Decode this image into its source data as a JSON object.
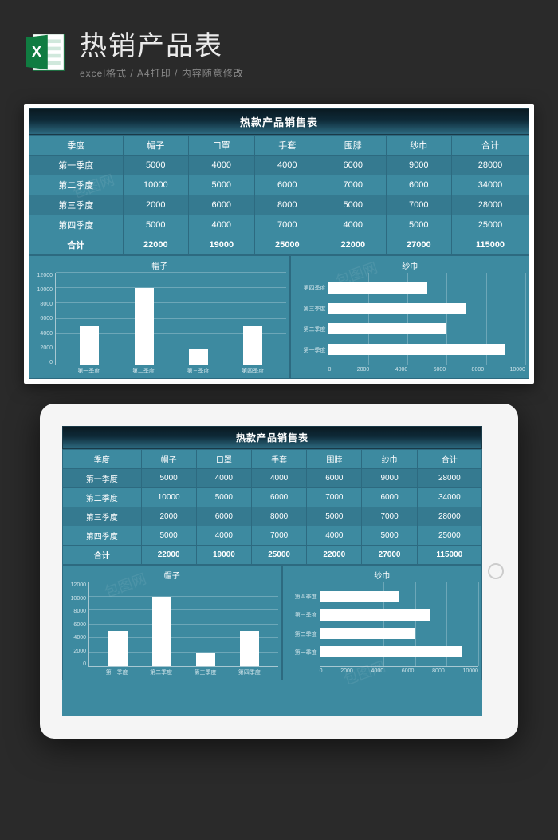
{
  "header": {
    "title": "热销产品表",
    "subtitle": "excel格式 / A4打印 / 内容随意修改"
  },
  "sheet": {
    "title": "热款产品销售表",
    "columns": [
      "季度",
      "帽子",
      "口罩",
      "手套",
      "围脖",
      "纱巾",
      "合计"
    ],
    "rows": [
      {
        "label": "第一季度",
        "cells": [
          5000,
          4000,
          4000,
          6000,
          9000,
          28000
        ]
      },
      {
        "label": "第二季度",
        "cells": [
          10000,
          5000,
          6000,
          7000,
          6000,
          34000
        ]
      },
      {
        "label": "第三季度",
        "cells": [
          2000,
          6000,
          8000,
          5000,
          7000,
          28000
        ]
      },
      {
        "label": "第四季度",
        "cells": [
          5000,
          4000,
          7000,
          4000,
          5000,
          25000
        ]
      }
    ],
    "total": {
      "label": "合计",
      "cells": [
        22000,
        19000,
        25000,
        22000,
        27000,
        115000
      ]
    }
  },
  "chart_data": [
    {
      "type": "bar",
      "title": "帽子",
      "categories": [
        "第一季度",
        "第二季度",
        "第三季度",
        "第四季度"
      ],
      "values": [
        5000,
        10000,
        2000,
        5000
      ],
      "xlabel": "",
      "ylabel": "",
      "ylim": [
        0,
        12000
      ],
      "yticks": [
        0,
        2000,
        4000,
        6000,
        8000,
        10000,
        12000
      ]
    },
    {
      "type": "bar",
      "orientation": "horizontal",
      "title": "纱巾",
      "categories": [
        "第四季度",
        "第三季度",
        "第二季度",
        "第一季度"
      ],
      "values": [
        5000,
        7000,
        6000,
        9000
      ],
      "xlabel": "",
      "ylabel": "",
      "xlim": [
        0,
        10000
      ],
      "xticks": [
        0,
        2000,
        4000,
        6000,
        8000,
        10000
      ]
    }
  ],
  "watermark": "包图网"
}
